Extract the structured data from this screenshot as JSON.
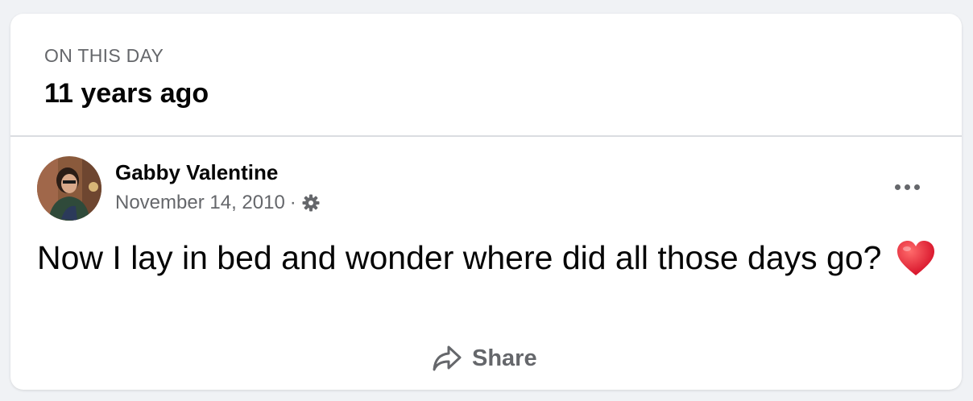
{
  "memory": {
    "kicker": "ON THIS DAY",
    "title": "11 years ago"
  },
  "post": {
    "author": "Gabby Valentine",
    "date": "November 14, 2010",
    "separator": "·",
    "privacy_icon": "gear-icon",
    "more_icon": "more-options-icon",
    "text": "Now I lay in bed and wonder where did all those days go?",
    "emoji": "red-heart-icon"
  },
  "actions": {
    "share_label": "Share",
    "share_icon": "share-arrow-icon"
  },
  "colors": {
    "background": "#f0f2f5",
    "card": "#ffffff",
    "secondary_text": "#65676b",
    "primary_text": "#050505",
    "heart": "#e0245e"
  }
}
